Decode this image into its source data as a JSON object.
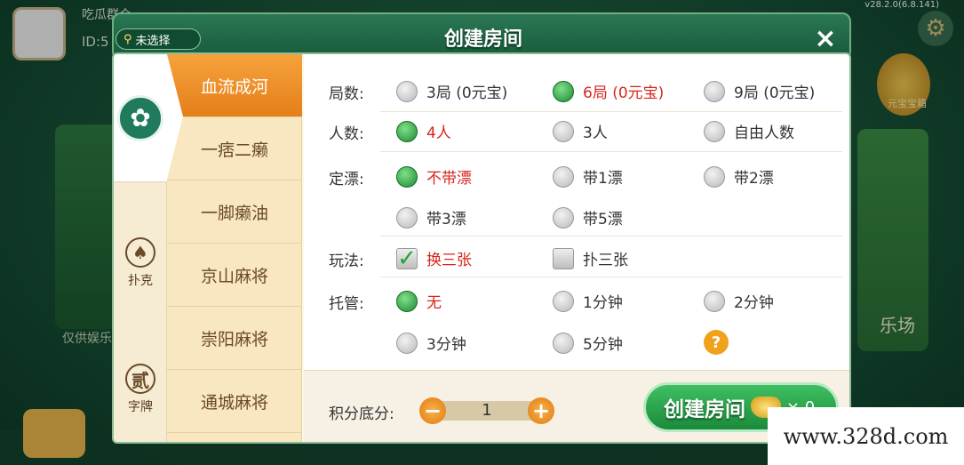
{
  "background": {
    "user_name": "吃瓜群众",
    "user_id_label": "ID:5",
    "version": "v28.2.0(6.8.141)",
    "left_card_text": "仅供娱乐",
    "right_emblem_text": "元宝宝箱",
    "right_card_text": "乐场"
  },
  "dialog": {
    "title": "创建房间",
    "location_label": "未选择",
    "close_symbol": "×"
  },
  "categories": [
    {
      "label": "",
      "icon": "mahjong-icon"
    },
    {
      "label": "扑克",
      "icon": "spade-icon",
      "glyph": "♠"
    },
    {
      "label": "字牌",
      "icon": "er-icon",
      "glyph": "贰"
    }
  ],
  "games": [
    {
      "label": "血流成河",
      "active": true
    },
    {
      "label": "一痞二癞",
      "active": false
    },
    {
      "label": "一脚癞油",
      "active": false
    },
    {
      "label": "京山麻将",
      "active": false
    },
    {
      "label": "崇阳麻将",
      "active": false
    },
    {
      "label": "通城麻将",
      "active": false
    }
  ],
  "options": {
    "rounds": {
      "label": "局数:",
      "choices": [
        "3局 (0元宝)",
        "6局 (0元宝)",
        "9局 (0元宝)"
      ],
      "selected": 1
    },
    "players": {
      "label": "人数:",
      "choices": [
        "4人",
        "3人",
        "自由人数"
      ],
      "selected": 0
    },
    "piao": {
      "label": "定漂:",
      "choices": [
        "不带漂",
        "带1漂",
        "带2漂",
        "带3漂",
        "带5漂"
      ],
      "selected": 0
    },
    "play": {
      "label": "玩法:",
      "choices": [
        "换三张",
        "扑三张"
      ],
      "checked": [
        true,
        false
      ]
    },
    "trustee": {
      "label": "托管:",
      "choices": [
        "无",
        "1分钟",
        "2分钟",
        "3分钟",
        "5分钟"
      ],
      "selected": 0,
      "help": "?"
    }
  },
  "score": {
    "label": "积分底分:",
    "value": "1",
    "minus": "−",
    "plus": "+"
  },
  "create": {
    "label": "创建房间",
    "cost": "× 0"
  },
  "watermark": "www.328d.com",
  "colors": {
    "accent_green": "#1d8a32",
    "selected_text": "#d6261e",
    "active_tab": "#e57f1a"
  }
}
